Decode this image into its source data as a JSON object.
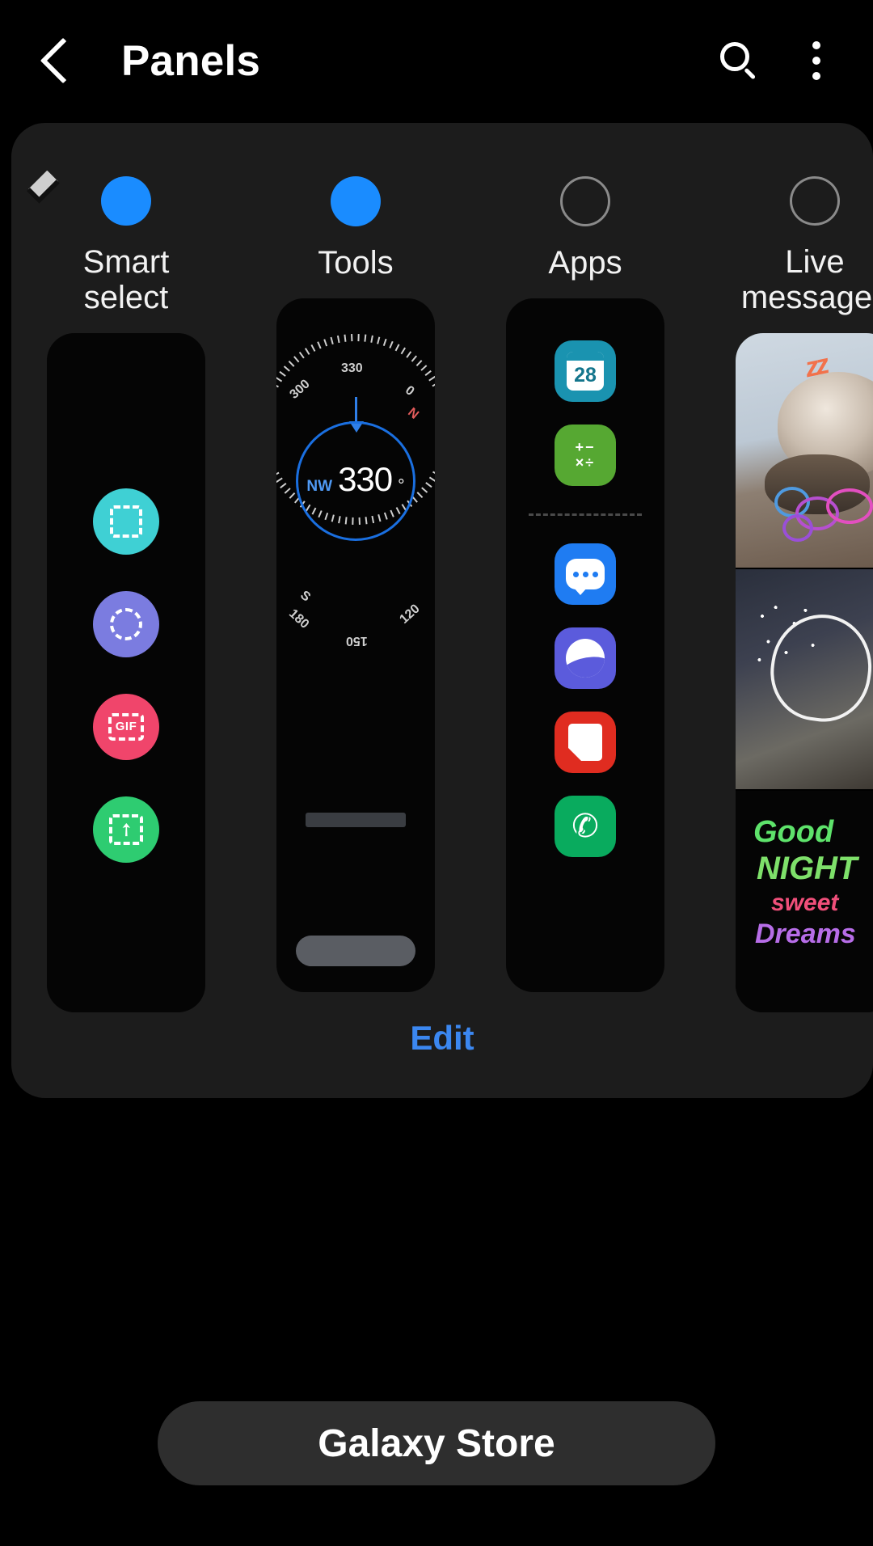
{
  "header": {
    "title": "Panels",
    "back_icon": "chevron-left-icon",
    "search_icon": "search-icon",
    "more_icon": "more-vertical-icon"
  },
  "panels": [
    {
      "label": "Smart\nselect",
      "checked": true,
      "type": "smart-select",
      "icons": [
        {
          "name": "rectangle-select-icon",
          "color": "#3fd0d4",
          "glyph": "rect"
        },
        {
          "name": "oval-select-icon",
          "color": "#7b7ce0",
          "glyph": "circle"
        },
        {
          "name": "gif-capture-icon",
          "color": "#f0456b",
          "glyph": "GIF"
        },
        {
          "name": "pin-to-screen-icon",
          "color": "#2ecc71",
          "glyph": "pin"
        }
      ]
    },
    {
      "label": "Tools",
      "checked": true,
      "type": "compass",
      "compass": {
        "direction": "NW",
        "degrees": "330",
        "degree_symbol": "°",
        "ticks": [
          "300",
          "330",
          "0",
          "N",
          "S",
          "180",
          "150",
          "120"
        ]
      }
    },
    {
      "label": "Apps",
      "checked": false,
      "type": "apps",
      "apps": [
        {
          "name": "calendar-app-icon",
          "badge": "28",
          "color": "#1a93b0"
        },
        {
          "name": "calculator-app-icon",
          "glyph": "+ −\n× ÷",
          "color": "#56a832"
        },
        {
          "name": "messages-app-icon",
          "color": "#1f7cf2"
        },
        {
          "name": "internet-app-icon",
          "color": "#5b5bdc"
        },
        {
          "name": "notes-app-icon",
          "color": "#e02c20"
        },
        {
          "name": "phone-app-icon",
          "color": "#09ab5e"
        }
      ]
    },
    {
      "label": "Live\nmessages",
      "checked": false,
      "type": "live-messages",
      "thumbnails": [
        {
          "name": "sleeping-dog-thumbnail",
          "doodle": "zz"
        },
        {
          "name": "sparkler-heart-thumbnail"
        },
        {
          "name": "handwriting-thumbnail",
          "lines": [
            "Good",
            "NIGHT",
            "sweet",
            "Dreams"
          ]
        }
      ]
    }
  ],
  "edit_label": "Edit",
  "store_button_label": "Galaxy Store",
  "colors": {
    "accent": "#1a8cff",
    "edit_link": "#3b87f0",
    "card_bg": "#1c1c1c",
    "page_bg": "#000000",
    "store_bg": "#2e2e2e"
  }
}
